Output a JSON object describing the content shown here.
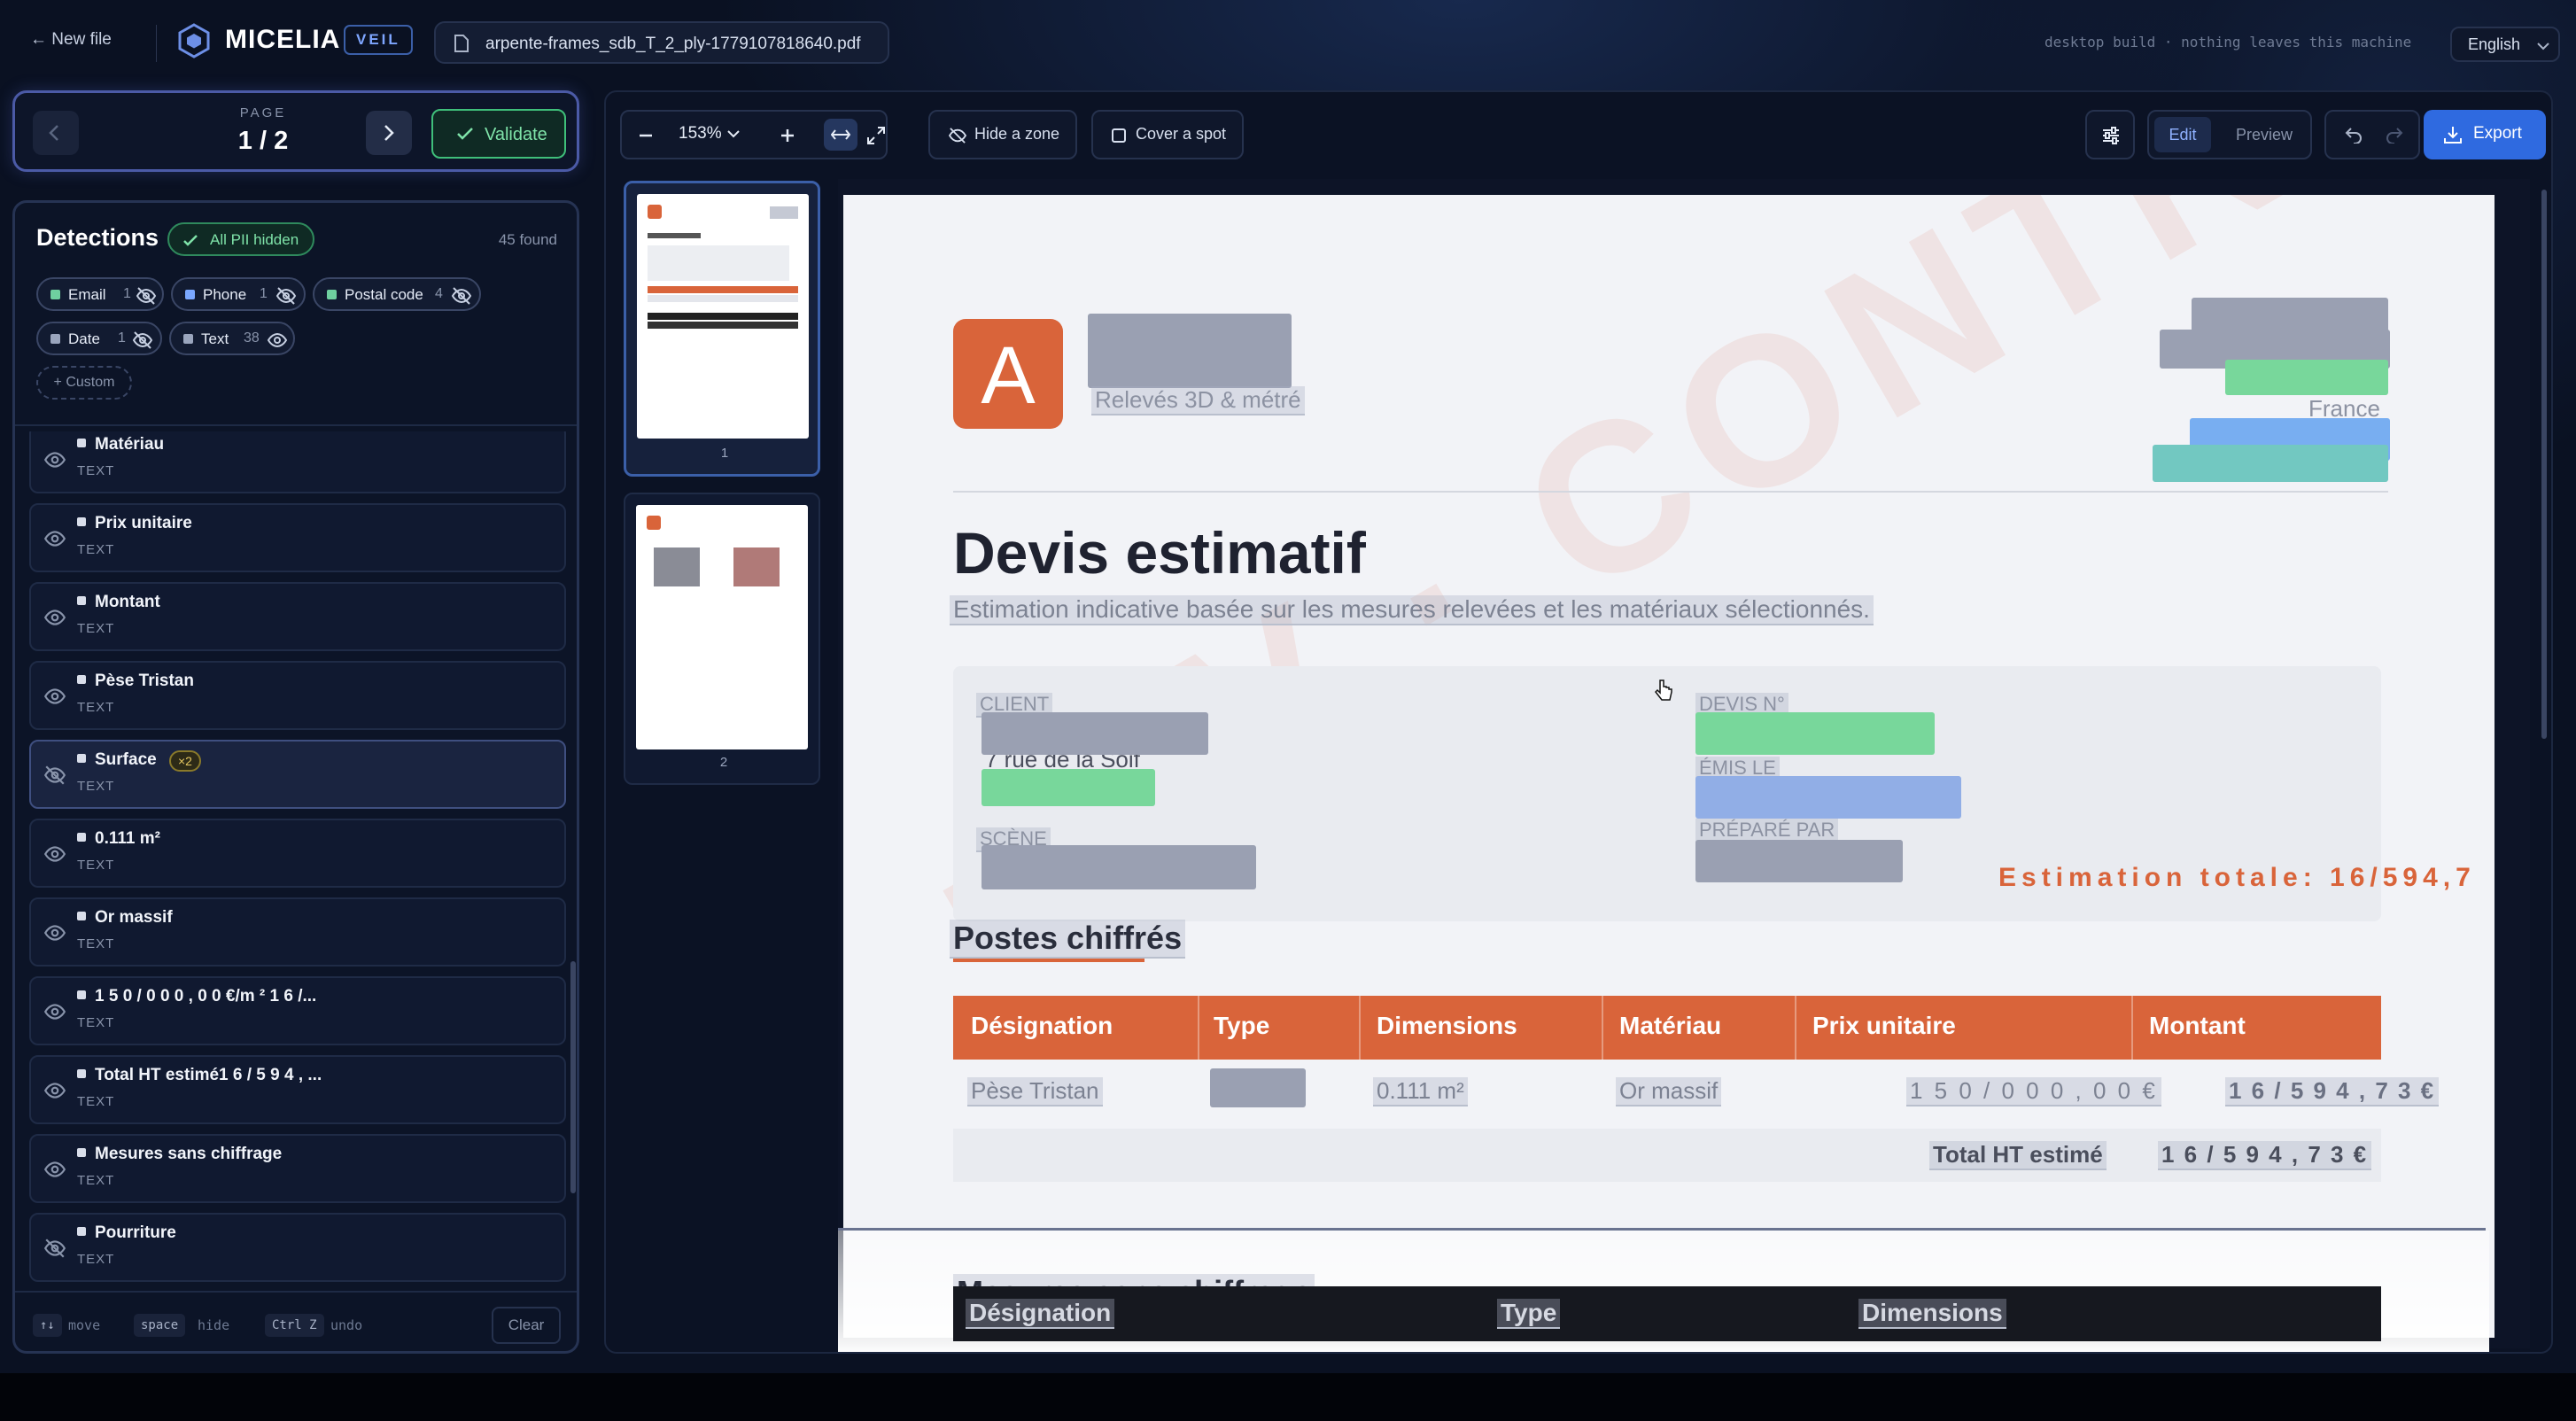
{
  "topbar": {
    "new_file": "← New file",
    "brand": "MICELIA",
    "badge": "VEIL",
    "filename": "arpente-frames_sdb_T_2_ply-1779107818640.pdf",
    "desktop_note": "desktop build · nothing leaves this machine",
    "language": "English"
  },
  "pager": {
    "label": "PAGE",
    "value": "1 / 2",
    "validate": "Validate"
  },
  "detections": {
    "title": "Detections",
    "status": "All PII hidden",
    "found": "45 found",
    "chips": [
      {
        "label": "Email",
        "count": "1",
        "color": "#6fd0a0"
      },
      {
        "label": "Phone",
        "count": "1",
        "color": "#7aa7ff"
      },
      {
        "label": "Postal code",
        "count": "4",
        "color": "#6fd0a0"
      },
      {
        "label": "Date",
        "count": "1",
        "color": "#9aa5bd"
      },
      {
        "label": "Text",
        "count": "38",
        "color": "#9aa5bd"
      }
    ],
    "custom": "+ Custom",
    "items": [
      {
        "name": "Matériau",
        "type": "TEXT",
        "hidden": false
      },
      {
        "name": "Prix unitaire",
        "type": "TEXT",
        "hidden": false
      },
      {
        "name": "Montant",
        "type": "TEXT",
        "hidden": false
      },
      {
        "name": "Pèse Tristan",
        "type": "TEXT",
        "hidden": false
      },
      {
        "name": "Surface",
        "type": "TEXT",
        "hidden": true,
        "badge": "×2"
      },
      {
        "name": "0.111 m²",
        "type": "TEXT",
        "hidden": false
      },
      {
        "name": "Or massif",
        "type": "TEXT",
        "hidden": false
      },
      {
        "name": "1 5 0 / 0 0 0 , 0 0 €/m ² 1 6 /...",
        "type": "TEXT",
        "hidden": false
      },
      {
        "name": "Total HT estimé1 6 / 5 9 4 , ...",
        "type": "TEXT",
        "hidden": false
      },
      {
        "name": "Mesures sans chiffrage",
        "type": "TEXT",
        "hidden": false
      },
      {
        "name": "Pourriture",
        "type": "TEXT",
        "hidden": true
      }
    ],
    "shortcuts": [
      {
        "key": "↑↓",
        "desc": "move"
      },
      {
        "key": "space",
        "desc": "hide"
      },
      {
        "key": "Ctrl Z",
        "desc": "undo"
      }
    ],
    "clear": "Clear"
  },
  "toolbar": {
    "zoom": "153%",
    "hide_zone": "Hide a zone",
    "cover_spot": "Cover a spot",
    "mode_edit": "Edit",
    "mode_preview": "Preview",
    "export": "Export"
  },
  "thumbnails": [
    {
      "num": "1",
      "active": true
    },
    {
      "num": "2",
      "active": false
    }
  ],
  "document": {
    "logo_letter": "A",
    "tagline": "Relevés 3D & métré",
    "country": "France",
    "title": "Devis estimatif",
    "subtitle": "Estimation indicative basée sur les mesures relevées et les matériaux sélectionnés.",
    "client_label": "CLIENT",
    "address_fragment": "7 rue de la Soif",
    "scene_label": "SCÈNE",
    "quote_no_label": "DEVIS N°",
    "issued_label": "ÉMIS LE",
    "prepared_label": "PRÉPARÉ PAR",
    "total_banner": "Estimation totale: 16/594,7",
    "watermark": "— V · CONTRACT",
    "section1": "Postes chiffrés",
    "table_headers": [
      "Désignation",
      "Type",
      "Dimensions",
      "Matériau",
      "Prix unitaire",
      "Montant"
    ],
    "row": {
      "designation": "Pèse Tristan",
      "dimensions": "0.111 m²",
      "material": "Or massif",
      "unit_price": "1 5 0 / 0 0 0 , 0 0  €",
      "amount": "1 6 / 5 9 4 , 7 3  €"
    },
    "total_label": "Total HT estimé",
    "total_value": "1 6 / 5 9 4 , 7 3  €",
    "section2": "Mesures sans chiffrage",
    "table2_headers": [
      "Désignation",
      "Type",
      "Dimensions"
    ]
  },
  "colors": {
    "accent": "#2f6ae0",
    "validate_green": "#3fbf7a",
    "doc_orange": "#d9643a",
    "redact_gray": "#9aa0b2",
    "redact_green": "#78d79b",
    "redact_blue": "#91aee6"
  }
}
